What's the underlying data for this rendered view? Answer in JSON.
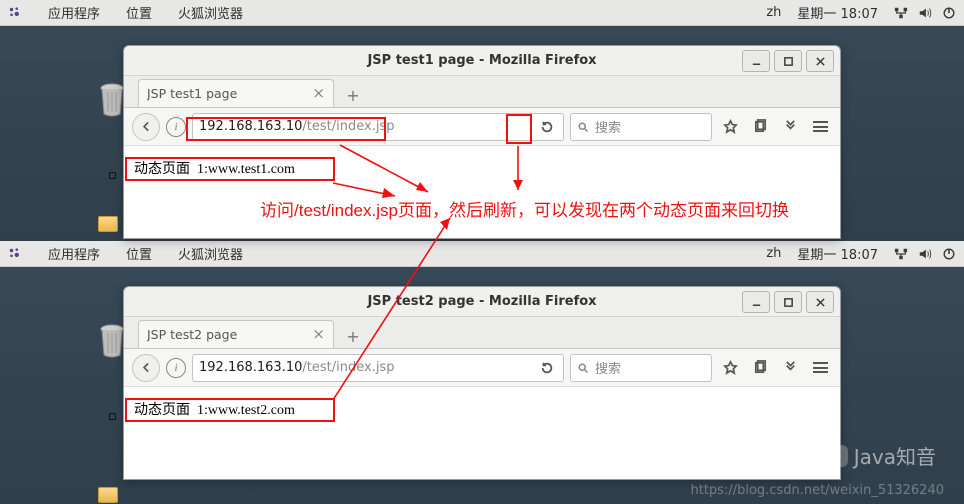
{
  "panel": {
    "apps": "应用程序",
    "places": "位置",
    "firefox": "火狐浏览器",
    "lang": "zh",
    "clock": "星期一 18:07"
  },
  "ff1": {
    "title": "JSP test1 page - Mozilla Firefox",
    "tab": "JSP test1 page",
    "url_host": "192.168.163.10",
    "url_path": "/test/index.jsp",
    "search_placeholder": "搜索",
    "content_label": "动态页面",
    "content_value": "1:www.test1.com"
  },
  "ff2": {
    "title": "JSP test2 page - Mozilla Firefox",
    "tab": "JSP test2 page",
    "url_host": "192.168.163.10",
    "url_path": "/test/index.jsp",
    "search_placeholder": "搜索",
    "content_label": "动态页面",
    "content_value": "1:www.test2.com"
  },
  "annotation": "访问/test/index.jsp页面，然后刷新，可以发现在两个动态页面来回切换",
  "watermark": {
    "brand": "Java知音",
    "url": "https://blog.csdn.net/weixin_51326240"
  }
}
